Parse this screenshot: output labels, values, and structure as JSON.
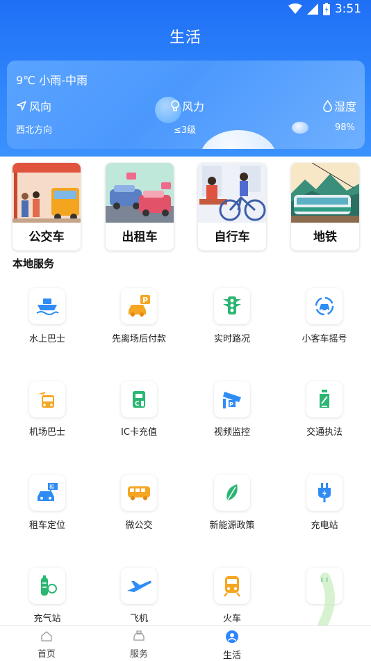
{
  "status_bar": {
    "time": "3:51"
  },
  "header": {
    "title": "生活"
  },
  "weather": {
    "summary": "9℃  小雨-中雨",
    "wind_direction": {
      "label": "风向",
      "value": "西北方向"
    },
    "wind_power": {
      "label": "风力",
      "value": "≤3级"
    },
    "humidity": {
      "label": "湿度",
      "value": "98%"
    }
  },
  "categories": [
    {
      "label": "公交车"
    },
    {
      "label": "出租车"
    },
    {
      "label": "自行车"
    },
    {
      "label": "地铁"
    }
  ],
  "local_services": {
    "title": "本地服务",
    "items": [
      {
        "label": "水上巴士",
        "icon": "ferry-icon"
      },
      {
        "label": "先离场后付款",
        "icon": "parking-car-icon"
      },
      {
        "label": "实时路况",
        "icon": "traffic-light-icon"
      },
      {
        "label": "小客车摇号",
        "icon": "car-lottery-icon"
      },
      {
        "label": "机场巴士",
        "icon": "airport-bus-icon"
      },
      {
        "label": "IC卡充值",
        "icon": "ic-card-recharge-icon"
      },
      {
        "label": "视频监控",
        "icon": "camera-icon"
      },
      {
        "label": "交通执法",
        "icon": "traffic-police-icon"
      },
      {
        "label": "租车定位",
        "icon": "rental-car-icon"
      },
      {
        "label": "微公交",
        "icon": "minibus-icon"
      },
      {
        "label": "新能源政策",
        "icon": "leaf-icon"
      },
      {
        "label": "充电站",
        "icon": "charging-plug-icon"
      },
      {
        "label": "充气站",
        "icon": "gas-cylinder-icon"
      },
      {
        "label": "飞机",
        "icon": "airplane-icon"
      },
      {
        "label": "火车",
        "icon": "train-icon"
      },
      {
        "label": "",
        "icon": "unknown-icon"
      }
    ]
  },
  "tabbar": {
    "tabs": [
      {
        "label": "首页",
        "icon": "home-icon",
        "active": false
      },
      {
        "label": "服务",
        "icon": "taxi-icon",
        "active": false
      },
      {
        "label": "生活",
        "icon": "user-circle-icon",
        "active": true
      }
    ]
  },
  "colors": {
    "primary": "#2f86fb",
    "icon_orange": "#f5a623",
    "icon_blue": "#2f8cf5",
    "icon_green": "#2bb673"
  }
}
